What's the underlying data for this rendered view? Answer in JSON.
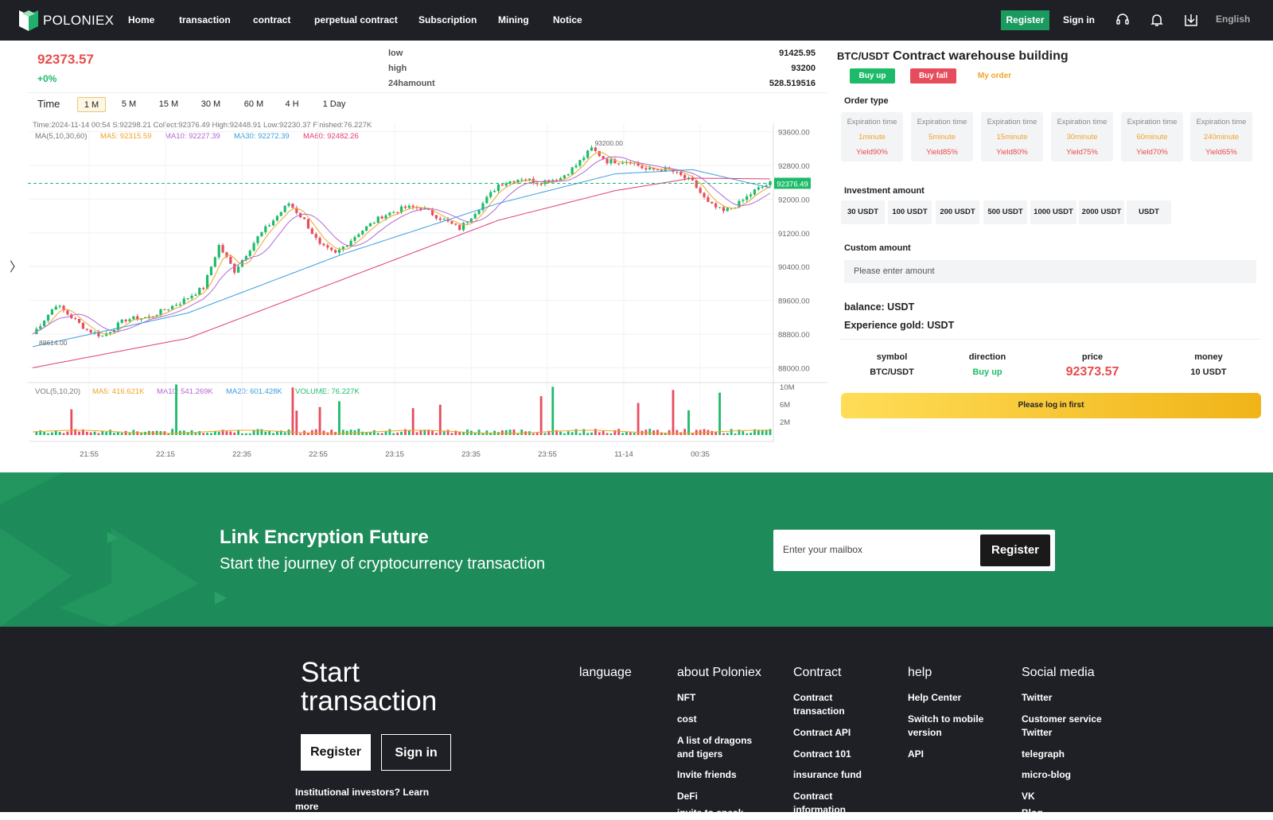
{
  "nav": {
    "logo": "POLONIEX",
    "items": [
      "Home",
      "transaction",
      "contract",
      "perpetual contract",
      "Subscription",
      "Mining",
      "Notice"
    ],
    "register": "Register",
    "signin": "Sign in",
    "language": "English",
    "icons": [
      "headset-icon",
      "bell-icon",
      "download-icon"
    ]
  },
  "ticker": {
    "price": "92373.57",
    "change": "+0%",
    "low_label": "low",
    "low": "91425.95",
    "high_label": "high",
    "high": "93200",
    "amount_label": "24hamount",
    "amount": "528.519516"
  },
  "timeframes": {
    "label": "Time",
    "items": [
      "1 M",
      "5 M",
      "15 M",
      "30 M",
      "60 M",
      "4 H",
      "1 Day"
    ],
    "active": "1 M"
  },
  "chart_info": {
    "line1": "Time:2024-11-14 00:54    S:92298.21    Collect:92376.49    High:92448.91    Low:92230.37    Finished:76.227K",
    "ma_label": "MA(5,10,30,60)",
    "ma5": "MA5: 92315.59",
    "ma10": "MA10: 92227.39",
    "ma30": "MA30: 92272.39",
    "ma60": "MA60: 92482.26",
    "vol_label": "VOL(5,10,20)",
    "vma5": "MA5: 416.621K",
    "vma10": "MA10: 541.269K",
    "vma20": "MA20: 601.428K",
    "volume": "VOLUME: 76.227K",
    "max_label": "93200.00",
    "min_label": "88614.00",
    "last_label": "92376.49"
  },
  "chart_data": {
    "type": "candlestick",
    "yticks": [
      "93600.00",
      "92800.00",
      "92000.00",
      "91200.00",
      "90400.00",
      "89600.00",
      "88800.00",
      "88000.00"
    ],
    "ylim": [
      87800,
      93800
    ],
    "vol_ticks": [
      "10M",
      "6M",
      "2M"
    ],
    "xticks": [
      "21:55",
      "22:15",
      "22:35",
      "22:55",
      "23:15",
      "23:35",
      "23:55",
      "11-14",
      "00:35"
    ],
    "close_path": [
      [
        0,
        88800
      ],
      [
        6,
        89500
      ],
      [
        10,
        89200
      ],
      [
        14,
        88900
      ],
      [
        18,
        88750
      ],
      [
        24,
        89150
      ],
      [
        30,
        89200
      ],
      [
        38,
        89550
      ],
      [
        44,
        89900
      ],
      [
        48,
        90900
      ],
      [
        52,
        90300
      ],
      [
        58,
        91100
      ],
      [
        62,
        91500
      ],
      [
        66,
        91900
      ],
      [
        70,
        91500
      ],
      [
        74,
        90900
      ],
      [
        78,
        90700
      ],
      [
        84,
        91200
      ],
      [
        90,
        91600
      ],
      [
        96,
        91800
      ],
      [
        100,
        91800
      ],
      [
        106,
        91500
      ],
      [
        110,
        91300
      ],
      [
        116,
        91900
      ],
      [
        120,
        92350
      ],
      [
        126,
        92500
      ],
      [
        130,
        92400
      ],
      [
        136,
        92500
      ],
      [
        140,
        92800
      ],
      [
        144,
        93200
      ],
      [
        148,
        92900
      ],
      [
        154,
        92900
      ],
      [
        158,
        92700
      ],
      [
        164,
        92700
      ],
      [
        170,
        92400
      ],
      [
        174,
        91900
      ],
      [
        178,
        91700
      ],
      [
        182,
        91900
      ],
      [
        186,
        92200
      ],
      [
        190,
        92380
      ]
    ],
    "ma60_path": [
      [
        0,
        88000
      ],
      [
        40,
        88700
      ],
      [
        80,
        90100
      ],
      [
        120,
        91500
      ],
      [
        150,
        92200
      ],
      [
        170,
        92500
      ],
      [
        190,
        92480
      ]
    ],
    "ma30_path": [
      [
        0,
        88500
      ],
      [
        40,
        89300
      ],
      [
        80,
        90700
      ],
      [
        120,
        91900
      ],
      [
        150,
        92600
      ],
      [
        170,
        92700
      ],
      [
        190,
        92270
      ]
    ]
  },
  "panel": {
    "pair": "BTC/USDT",
    "title": "Contract warehouse building",
    "buy_up": "Buy up",
    "buy_fall": "Buy fall",
    "my_order": "My order",
    "order_type": "Order type",
    "cards": [
      {
        "label": "Expiration time",
        "time": "1minute",
        "yield": "Yield90%"
      },
      {
        "label": "Expiration time",
        "time": "5minute",
        "yield": "Yield85%"
      },
      {
        "label": "Expiration time",
        "time": "15minute",
        "yield": "Yield80%"
      },
      {
        "label": "Expiration time",
        "time": "30minute",
        "yield": "Yield75%"
      },
      {
        "label": "Expiration time",
        "time": "60minute",
        "yield": "Yield70%"
      },
      {
        "label": "Expiration time",
        "time": "240minute",
        "yield": "Yield65%"
      }
    ],
    "investment_label": "Investment amount",
    "amounts": [
      "30 USDT",
      "100 USDT",
      "200 USDT",
      "500 USDT",
      "1000 USDT",
      "2000 USDT",
      "USDT"
    ],
    "custom_label": "Custom amount",
    "custom_placeholder": "Please enter amount",
    "balance": "balance:   USDT",
    "experience": "Experience gold:   USDT",
    "order_headers": [
      "symbol",
      "direction",
      "price",
      "money"
    ],
    "order_values": [
      "BTC/USDT",
      "Buy up",
      "92373.57",
      "10 USDT"
    ],
    "login_btn": "Please log in first"
  },
  "banner": {
    "title": "Link Encryption Future",
    "subtitle": "Start the journey of cryptocurrency transaction",
    "mail_placeholder": "Enter your mailbox",
    "register": "Register"
  },
  "footer": {
    "title": "Start transaction",
    "register": "Register",
    "signin": "Sign in",
    "institutional": "Institutional investors? Learn more",
    "columns": [
      {
        "title": "language",
        "links": []
      },
      {
        "title": "about Poloniex",
        "links": [
          "NFT",
          "cost",
          "A list of dragons and tigers",
          "Invite friends",
          "DeFi",
          "invite to speak"
        ]
      },
      {
        "title": "Contract",
        "links": [
          "Contract transaction",
          "Contract API",
          "Contract 101",
          "insurance fund",
          "Contract information"
        ]
      },
      {
        "title": "help",
        "links": [
          "Help Center",
          "Switch to mobile version",
          "API"
        ]
      },
      {
        "title": "Social media",
        "links": [
          "Twitter",
          "Customer service Twitter",
          "telegraph",
          "micro-blog",
          "VK",
          "Blog"
        ]
      }
    ]
  }
}
